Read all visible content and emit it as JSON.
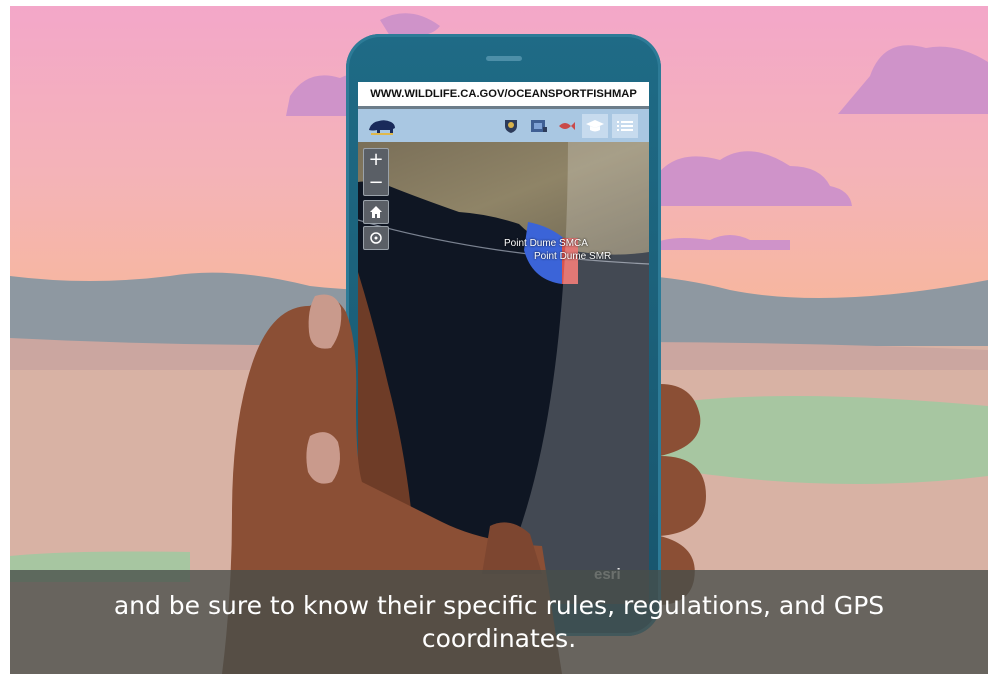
{
  "browser": {
    "url": "WWW.WILDLIFE.CA.GOV/OCEANSPORTFISHMAP"
  },
  "map": {
    "zoom_in": "+",
    "zoom_out": "−",
    "labels": [
      "Point Dume SMCA",
      "Point Dume SMR"
    ],
    "attribution": "esri"
  },
  "caption": {
    "text": "and be sure to know their specific rules, regulations, and GPS coordinates."
  },
  "colors": {
    "smca": "#3b64d8",
    "smr": "#d9534f",
    "appbar": "#a9c7e2"
  },
  "icons": [
    "bear-logo-icon",
    "badge-icon",
    "map-layers-icon",
    "fish-icon",
    "graduation-cap-icon",
    "list-icon",
    "home-icon",
    "locate-icon"
  ]
}
